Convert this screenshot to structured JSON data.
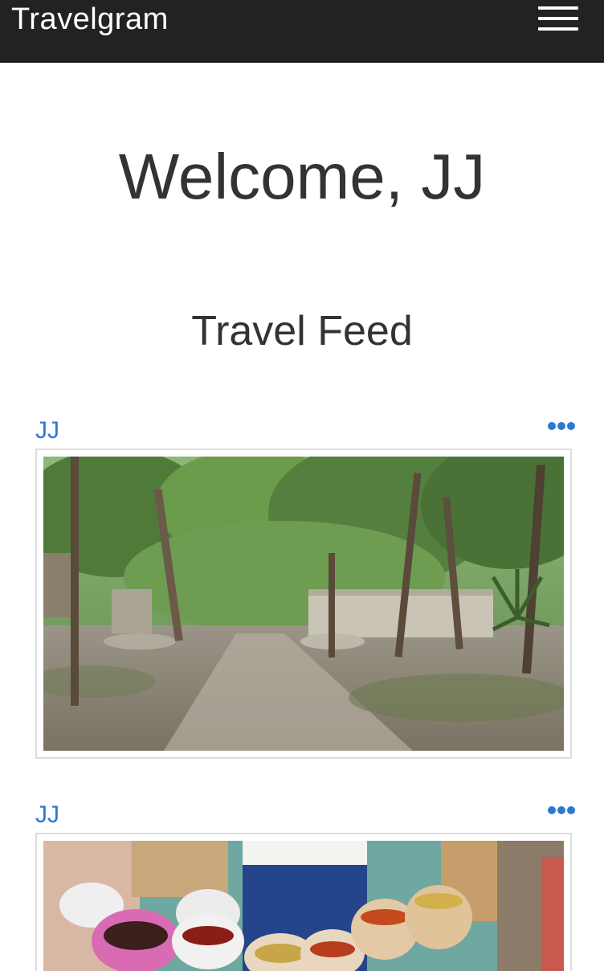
{
  "navbar": {
    "brand": "Travelgram",
    "menu_icon": "hamburger-menu-icon",
    "background": "#222222"
  },
  "main": {
    "welcome": "Welcome, JJ",
    "feed_title": "Travel Feed"
  },
  "feed": {
    "posts": [
      {
        "author": "JJ",
        "more_icon": "more-options-icon",
        "image_subject": "forest path with stone ruins"
      },
      {
        "author": "JJ",
        "more_icon": "more-options-icon",
        "image_subject": "market sacks of dried chilies and grains"
      }
    ]
  },
  "colors": {
    "link": "#2a7ad3",
    "text": "#333333",
    "frame_border": "#dddddd"
  }
}
